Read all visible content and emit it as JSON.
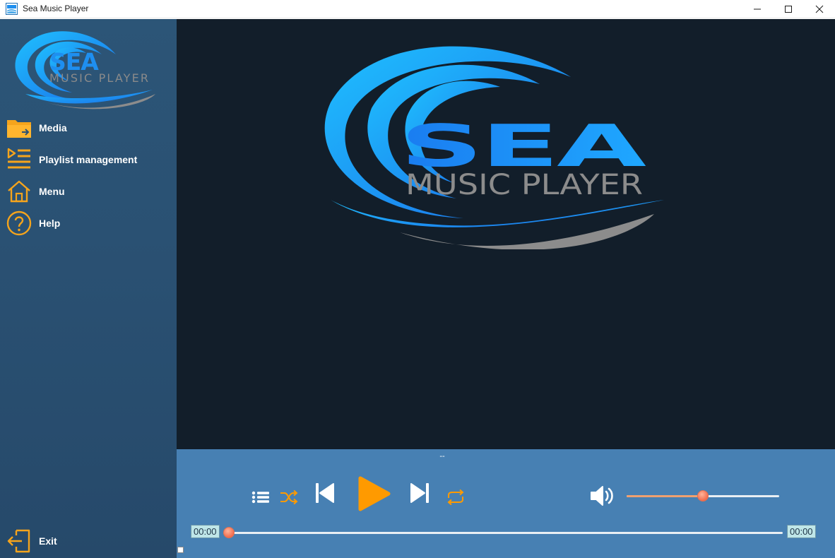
{
  "window": {
    "title": "Sea Music Player",
    "icon": "sea-app-icon",
    "controls": [
      "minimize-icon",
      "maximize-icon",
      "close-icon"
    ]
  },
  "brand": {
    "logo_top": "SEA",
    "logo_bottom": "MUSIC PLAYER",
    "colors": {
      "blue": "#1e8ff0",
      "light_blue": "#1fc0ff",
      "gray_wave": "#8c8c8c"
    }
  },
  "sidebar": {
    "items": [
      {
        "label": "Media",
        "icon": "folder-icon"
      },
      {
        "label": "Playlist management",
        "icon": "playlist-icon"
      },
      {
        "label": "Menu",
        "icon": "home-icon"
      },
      {
        "label": "Help",
        "icon": "help-icon"
      }
    ],
    "exit": {
      "label": "Exit",
      "icon": "exit-icon"
    },
    "accent": "#f5a41c"
  },
  "player": {
    "track_title": "--",
    "current_time": "00:00",
    "total_time": "00:00",
    "progress": 0,
    "volume": 0.5,
    "buttons": [
      "playlist-icon",
      "shuffle-icon",
      "previous-icon",
      "play-icon",
      "next-icon",
      "repeat-icon",
      "volume-icon"
    ],
    "colors": {
      "bar": "#4780b3",
      "play": "#ff9a00",
      "slider_fill": "#f0a070",
      "knob": "#f26d4f"
    }
  }
}
